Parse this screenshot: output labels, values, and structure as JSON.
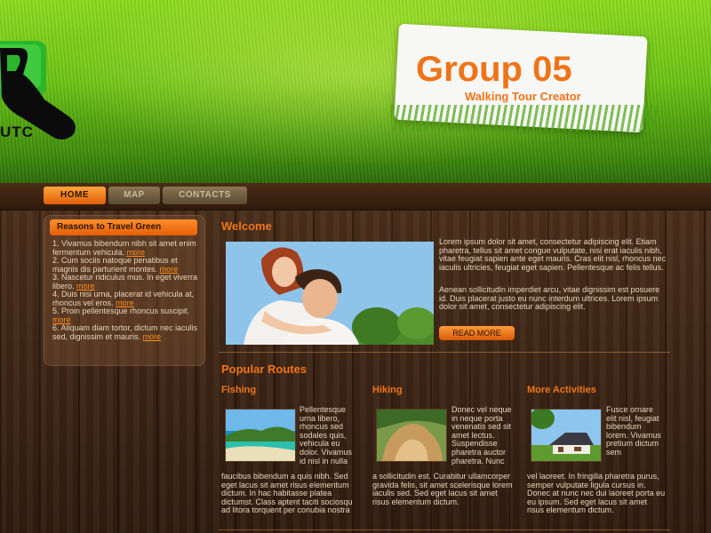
{
  "brand": {
    "logo_text": "UTC",
    "title": "Group 05",
    "subtitle": "Walking Tour Creator"
  },
  "nav": {
    "home": "HOME",
    "map": "MAP",
    "contacts": "CONTACTS"
  },
  "sidebar": {
    "title": "Reasons to Travel Green",
    "more": "more",
    "items": [
      "1. Vivamus bibendum nibh sit amet enim fermentum vehicula.",
      "2. Cum sociis natoque penatibus et magnis dis parturient montes.",
      "3. Nascetur ridiculus mus. In eget viverra libero.",
      "4. Duis nisi urna, placerat id vehicula at, rhoncus vel eros.",
      "5. Proin pellentesque rhoncus suscipit.",
      "6. Aliquam diam tortor, dictum nec iaculis sed, dignissim et mauris."
    ]
  },
  "welcome": {
    "heading": "Welcome",
    "para1": "Lorem ipsum dolor sit amet, consectetur adipiscing elit. Etiam pharetra, tellus sit amet congue vulputate, nisi erat iaculis nibh, vitae feugiat sapien ante eget mauris. Cras elit nisl, rhoncus nec iaculis ultricies, feugiat eget sapien. Pellentesque ac felis tellus.",
    "para2": "Aenean sollicitudin imperdiet arcu, vitae dignissim est posuere id. Duis placerat justo eu nunc interdum ultrices. Lorem ipsum dolor sit amet, consectetur adipiscing elit.",
    "read_more": "READ MORE"
  },
  "routes": {
    "heading": "Popular Routes",
    "columns": [
      {
        "title": "Fishing",
        "side": "Pellentesque urna libero, rhoncus sed sodales quis, vehicula eu dolor. Vivamus id nisl in nulla",
        "bottom": "faucibus bibendum a quis nibh. Sed eget lacus sit amet risus elementum dictum. In hac habitasse platea dictumst. Class aptent taciti sociosqu ad litora torquent per conubia nostra"
      },
      {
        "title": "Hiking",
        "side": "Donec vel neque in neque porta venenatis sed sit amet lectus. Suspendisse pharetra auctor pharetra. Nunc",
        "bottom": "a sollicitudin est. Curabitur ullamcorper gravida felis, sit amet scelerisque lorem iaculis sed. Sed eget lacus sit amet risus elementum dictum."
      },
      {
        "title": "More Activities",
        "side": "Fusce ornare elit nisl, feugiat bibendum lorem. Vivamus pretium dictum sem",
        "bottom": "vel laoreet. In fringilla pharetra purus, semper vulputate ligula cursus in. Donec at nunc nec dui laoreet porta eu eu ipsum. Sed eget lacus sit amet risus elementum dictum."
      }
    ]
  },
  "colors": {
    "accent": "#ef7418",
    "grass": "#6bc415",
    "wood": "#3a2314"
  }
}
